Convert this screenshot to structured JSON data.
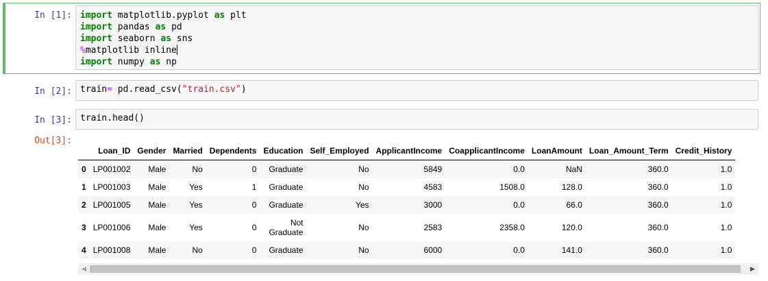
{
  "cells": [
    {
      "prompt": "In [1]:",
      "lines": [
        [
          {
            "t": "import",
            "c": "kw"
          },
          {
            "t": " matplotlib.pyplot "
          },
          {
            "t": "as",
            "c": "kw"
          },
          {
            "t": " plt"
          }
        ],
        [
          {
            "t": "import",
            "c": "kw"
          },
          {
            "t": " pandas "
          },
          {
            "t": "as",
            "c": "kw"
          },
          {
            "t": " pd"
          }
        ],
        [
          {
            "t": "import",
            "c": "kw"
          },
          {
            "t": " seaborn "
          },
          {
            "t": "as",
            "c": "kw"
          },
          {
            "t": " sns"
          }
        ],
        [
          {
            "t": "%",
            "c": "magic"
          },
          {
            "t": "matplotlib inline"
          }
        ],
        [
          {
            "t": "import",
            "c": "kw"
          },
          {
            "t": " numpy "
          },
          {
            "t": "as",
            "c": "kw"
          },
          {
            "t": " np"
          }
        ]
      ]
    },
    {
      "prompt": "In [2]:",
      "lines": [
        [
          {
            "t": "train"
          },
          {
            "t": "=",
            "c": "op"
          },
          {
            "t": " pd.read_csv("
          },
          {
            "t": "\"train.csv\"",
            "c": "str"
          },
          {
            "t": ")"
          }
        ]
      ]
    },
    {
      "prompt": "In [3]:",
      "lines": [
        [
          {
            "t": "train.head()"
          }
        ]
      ]
    }
  ],
  "output": {
    "prompt": "Out[3]:",
    "columns": [
      "",
      "Loan_ID",
      "Gender",
      "Married",
      "Dependents",
      "Education",
      "Self_Employed",
      "ApplicantIncome",
      "CoapplicantIncome",
      "LoanAmount",
      "Loan_Amount_Term",
      "Credit_History"
    ],
    "rows": [
      [
        "0",
        "LP001002",
        "Male",
        "No",
        "0",
        "Graduate",
        "No",
        "5849",
        "0.0",
        "NaN",
        "360.0",
        "1.0"
      ],
      [
        "1",
        "LP001003",
        "Male",
        "Yes",
        "1",
        "Graduate",
        "No",
        "4583",
        "1508.0",
        "128.0",
        "360.0",
        "1.0"
      ],
      [
        "2",
        "LP001005",
        "Male",
        "Yes",
        "0",
        "Graduate",
        "Yes",
        "3000",
        "0.0",
        "66.0",
        "360.0",
        "1.0"
      ],
      [
        "3",
        "LP001006",
        "Male",
        "Yes",
        "0",
        "Not Graduate",
        "No",
        "2583",
        "2358.0",
        "120.0",
        "360.0",
        "1.0"
      ],
      [
        "4",
        "LP001008",
        "Male",
        "No",
        "0",
        "Graduate",
        "No",
        "6000",
        "0.0",
        "141.0",
        "360.0",
        "1.0"
      ]
    ]
  },
  "scrollbar": {
    "left_arrow": "◀",
    "right_arrow": "▶"
  },
  "colors": {
    "selected_cell_border": "#66bb6a",
    "in_prompt": "#303f9f",
    "out_prompt": "#d84315"
  }
}
